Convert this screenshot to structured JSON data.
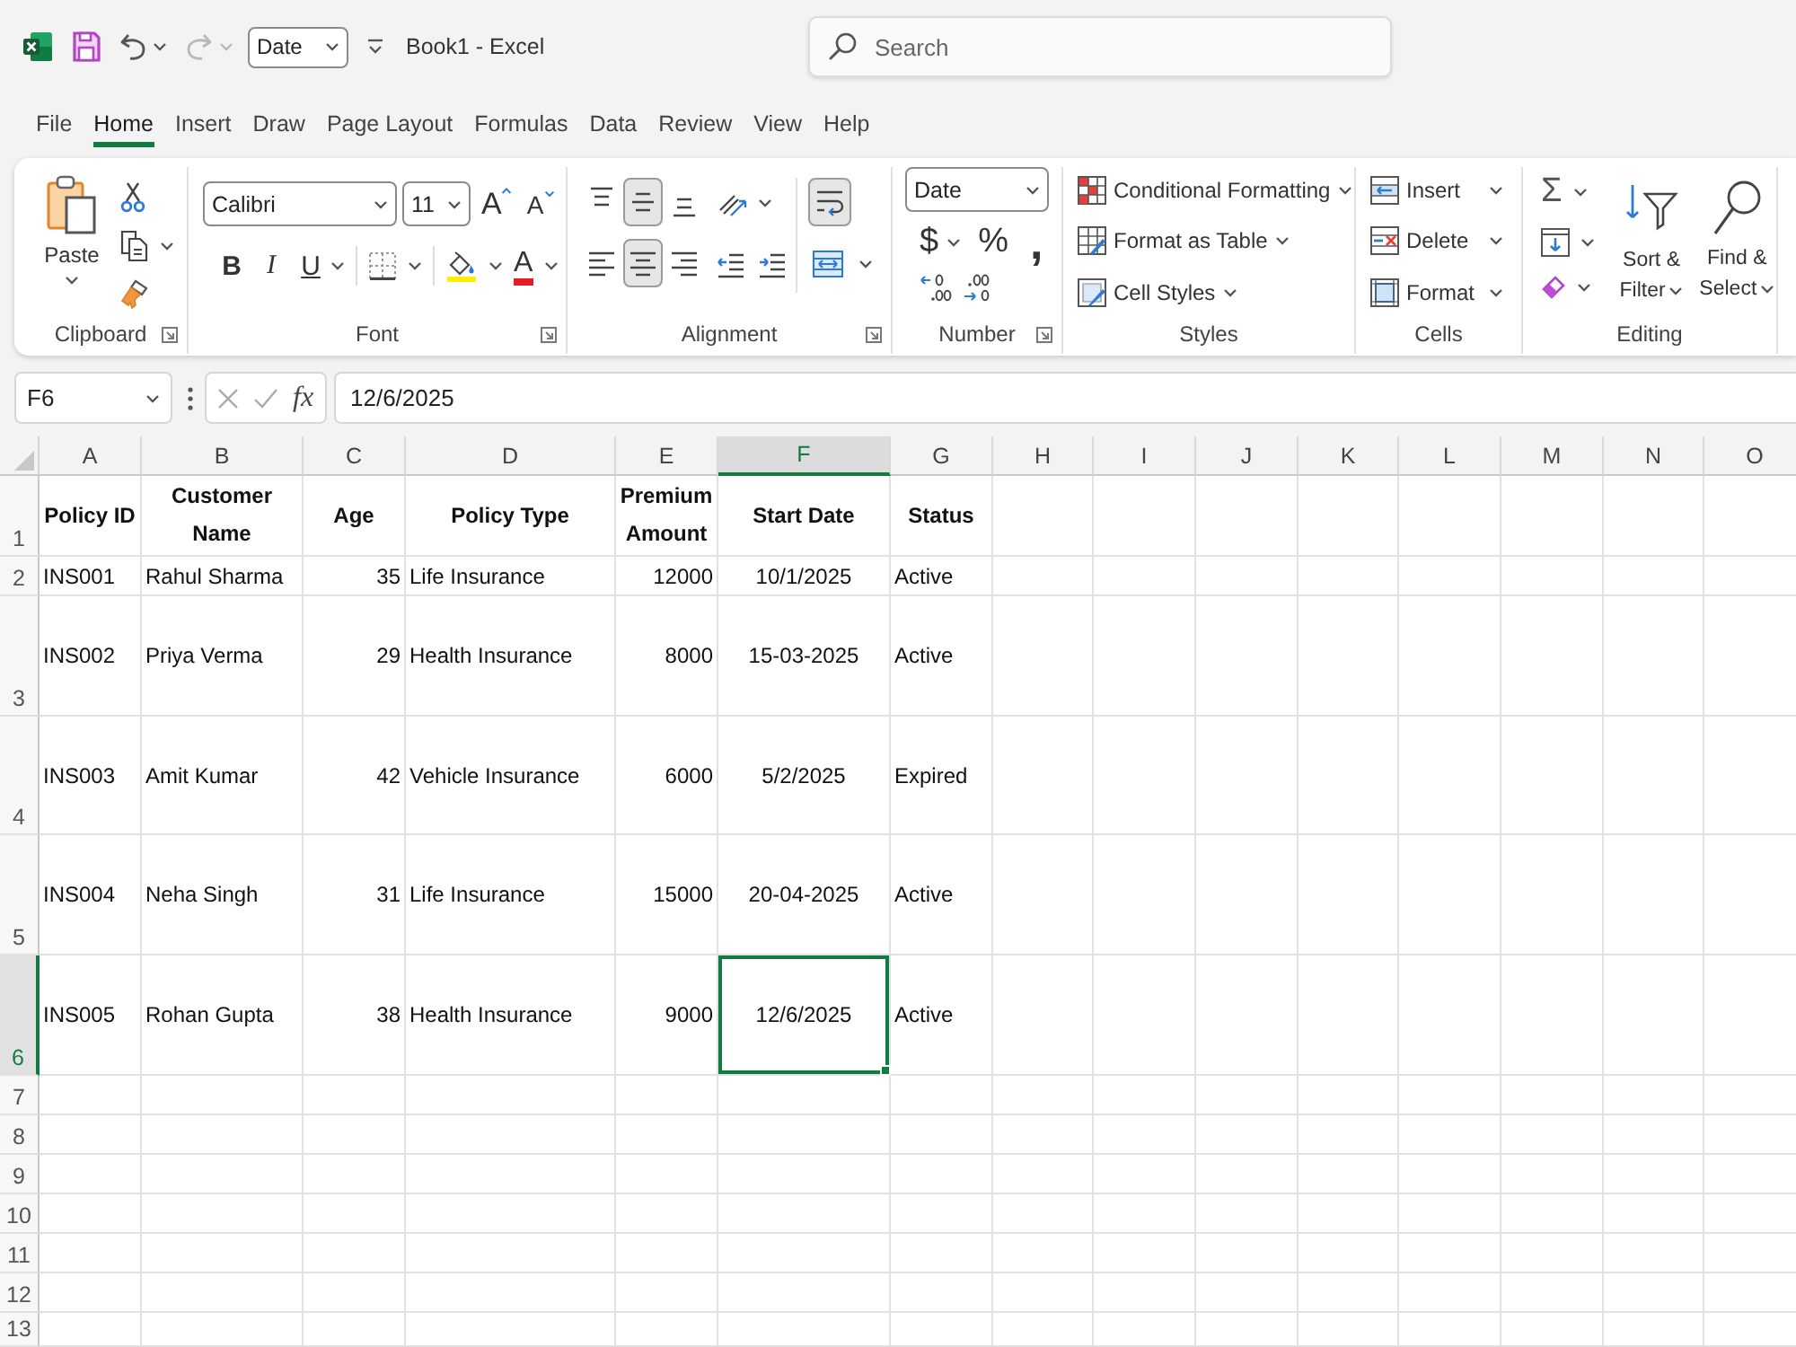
{
  "title_bar": {
    "undo": {
      "disabled": false
    },
    "redo": {
      "disabled": true
    },
    "number_format": "Date",
    "title": "Book1 - Excel",
    "search": {
      "placeholder": "Search"
    }
  },
  "tabs": [
    {
      "label": "File",
      "selected": false
    },
    {
      "label": "Home",
      "selected": true
    },
    {
      "label": "Insert",
      "selected": false
    },
    {
      "label": "Draw",
      "selected": false
    },
    {
      "label": "Page Layout",
      "selected": false
    },
    {
      "label": "Formulas",
      "selected": false
    },
    {
      "label": "Data",
      "selected": false
    },
    {
      "label": "Review",
      "selected": false
    },
    {
      "label": "View",
      "selected": false
    },
    {
      "label": "Help",
      "selected": false
    }
  ],
  "ribbon": {
    "groups": [
      {
        "kind": "clipboard",
        "label": "Clipboard",
        "launcher": true,
        "paste": "Paste"
      },
      {
        "kind": "font",
        "label": "Font",
        "launcher": true,
        "font_name": "Calibri",
        "font_size": "11",
        "grow_font": "A",
        "shrink_font": "A",
        "bold": "B",
        "italic": "I",
        "underline": "U",
        "font_color": "A"
      },
      {
        "kind": "alignment",
        "label": "Alignment",
        "launcher": true,
        "vertical": [
          {
            "kind": "top",
            "selected": false
          },
          {
            "kind": "middle",
            "selected": true
          },
          {
            "kind": "bottom",
            "selected": false
          }
        ],
        "horizontal": [
          {
            "kind": "left",
            "selected": false
          },
          {
            "kind": "center",
            "selected": true
          },
          {
            "kind": "right",
            "selected": false
          }
        ],
        "wrap_text": {
          "selected": true
        }
      },
      {
        "kind": "number",
        "label": "Number",
        "launcher": true,
        "format": "Date",
        "currency": "$",
        "percent": "%",
        "comma": ","
      },
      {
        "kind": "styles",
        "label": "Styles",
        "commands": [
          {
            "kind": "conditional",
            "label": "Conditional Formatting"
          },
          {
            "kind": "table",
            "label": "Format as Table"
          },
          {
            "kind": "cell_styles",
            "label": "Cell Styles"
          }
        ]
      },
      {
        "kind": "cells",
        "label": "Cells",
        "commands": [
          {
            "kind": "insert",
            "label": "Insert"
          },
          {
            "kind": "delete",
            "label": "Delete"
          },
          {
            "kind": "format",
            "label": "Format"
          }
        ]
      },
      {
        "kind": "editing",
        "label": "Editing",
        "autosum": "Σ",
        "sort": "Sort & Filter",
        "find": "Find & Select"
      }
    ]
  },
  "formula_bar": {
    "name_box": "F6",
    "insert_function": "fx",
    "formula": "12/6/2025"
  },
  "sheet": {
    "columns": [
      {
        "letter": "A",
        "selected": false
      },
      {
        "letter": "B",
        "selected": false
      },
      {
        "letter": "C",
        "selected": false
      },
      {
        "letter": "D",
        "selected": false
      },
      {
        "letter": "E",
        "selected": false
      },
      {
        "letter": "F",
        "selected": true
      },
      {
        "letter": "G",
        "selected": false
      },
      {
        "letter": "H",
        "selected": false
      },
      {
        "letter": "I",
        "selected": false
      },
      {
        "letter": "J",
        "selected": false
      },
      {
        "letter": "K",
        "selected": false
      },
      {
        "letter": "L",
        "selected": false
      },
      {
        "letter": "M",
        "selected": false
      },
      {
        "letter": "N",
        "selected": false
      },
      {
        "letter": "O",
        "selected": false
      }
    ],
    "rows": [
      {
        "number": "1",
        "selected": false,
        "kind": "header",
        "cells": [
          {
            "text": "Policy ID",
            "selected": false
          },
          {
            "text": "Customer Name",
            "selected": false
          },
          {
            "text": "Age",
            "selected": false
          },
          {
            "text": "Policy Type",
            "selected": false
          },
          {
            "text": "Premium Amount",
            "selected": false
          },
          {
            "text": "Start Date",
            "selected": false
          },
          {
            "text": "Status",
            "selected": false
          }
        ]
      },
      {
        "number": "2",
        "selected": false,
        "kind": "data",
        "cells": [
          {
            "text": "INS001",
            "selected": false
          },
          {
            "text": "Rahul Sharma",
            "selected": false
          },
          {
            "text": "35",
            "selected": false
          },
          {
            "text": "Life Insurance",
            "selected": false
          },
          {
            "text": "12000",
            "selected": false
          },
          {
            "text": "10/1/2025",
            "selected": false
          },
          {
            "text": "Active",
            "selected": false
          }
        ]
      },
      {
        "number": "3",
        "selected": false,
        "kind": "data",
        "cells": [
          {
            "text": "INS002",
            "selected": false
          },
          {
            "text": "Priya Verma",
            "selected": false
          },
          {
            "text": "29",
            "selected": false
          },
          {
            "text": "Health Insurance",
            "selected": false
          },
          {
            "text": "8000",
            "selected": false
          },
          {
            "text": "15-03-2025",
            "selected": false
          },
          {
            "text": "Active",
            "selected": false
          }
        ]
      },
      {
        "number": "4",
        "selected": false,
        "kind": "data",
        "cells": [
          {
            "text": "INS003",
            "selected": false
          },
          {
            "text": "Amit Kumar",
            "selected": false
          },
          {
            "text": "42",
            "selected": false
          },
          {
            "text": "Vehicle Insurance",
            "selected": false
          },
          {
            "text": "6000",
            "selected": false
          },
          {
            "text": "5/2/2025",
            "selected": false
          },
          {
            "text": "Expired",
            "selected": false
          }
        ]
      },
      {
        "number": "5",
        "selected": false,
        "kind": "data",
        "cells": [
          {
            "text": "INS004",
            "selected": false
          },
          {
            "text": "Neha Singh",
            "selected": false
          },
          {
            "text": "31",
            "selected": false
          },
          {
            "text": "Life Insurance",
            "selected": false
          },
          {
            "text": "15000",
            "selected": false
          },
          {
            "text": "20-04-2025",
            "selected": false
          },
          {
            "text": "Active",
            "selected": false
          }
        ]
      },
      {
        "number": "6",
        "selected": true,
        "kind": "data",
        "cells": [
          {
            "text": "INS005",
            "selected": false
          },
          {
            "text": "Rohan Gupta",
            "selected": false
          },
          {
            "text": "38",
            "selected": false
          },
          {
            "text": "Health Insurance",
            "selected": false
          },
          {
            "text": "9000",
            "selected": false
          },
          {
            "text": "12/6/2025",
            "selected": true
          },
          {
            "text": "Active",
            "selected": false
          }
        ]
      },
      {
        "number": "7",
        "selected": false
      },
      {
        "number": "8",
        "selected": false
      },
      {
        "number": "9",
        "selected": false
      },
      {
        "number": "10",
        "selected": false
      },
      {
        "number": "11",
        "selected": false
      },
      {
        "number": "12",
        "selected": false
      },
      {
        "number": "13",
        "selected": false
      }
    ]
  }
}
